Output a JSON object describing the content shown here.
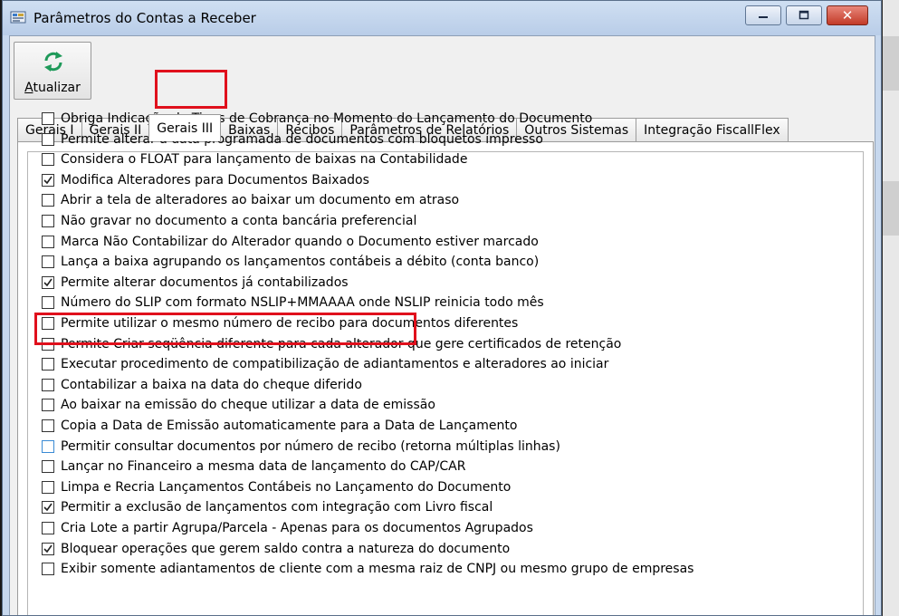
{
  "window": {
    "title": "Parâmetros do Contas a Receber",
    "close_glyph": "✕"
  },
  "toolbar": {
    "refresh_label_first": "A",
    "refresh_label_rest": "tualizar",
    "refresh_icon": "refresh-icon",
    "accent": "#1f9a5a"
  },
  "tabs": [
    {
      "label": "Gerais I",
      "active": false
    },
    {
      "label": "Gerais II",
      "active": false
    },
    {
      "label": "Gerais III",
      "active": true
    },
    {
      "label": "Baixas",
      "active": false
    },
    {
      "label": "Recibos",
      "active": false
    },
    {
      "label": "Parâmetros de Relatórios",
      "active": false
    },
    {
      "label": "Outros Sistemas",
      "active": false
    },
    {
      "label": "Integração FiscallFlex",
      "active": false
    }
  ],
  "highlight_color": "#e0101c",
  "options": [
    {
      "label": "Obriga Indicação de Tipos de Cobrança no Momento do Lançamento do Documento",
      "checked": false
    },
    {
      "label": "Permite alterar a data programada de documentos com bloquetos impresso",
      "checked": false
    },
    {
      "label": "Considera o FLOAT para lançamento de baixas na Contabilidade",
      "checked": false
    },
    {
      "label": "Modifica Alteradores para Documentos Baixados",
      "checked": true
    },
    {
      "label": "Abrir a tela de alteradores ao baixar um documento em atraso",
      "checked": false
    },
    {
      "label": "Não gravar no documento a conta bancária preferencial",
      "checked": false
    },
    {
      "label": "Marca Não Contabilizar do Alterador quando o Documento estiver marcado",
      "checked": false
    },
    {
      "label": "Lança a baixa agrupando os lançamentos contábeis a débito (conta banco)",
      "checked": false
    },
    {
      "label": "Permite alterar documentos já contabilizados",
      "checked": true
    },
    {
      "label": "Número do SLIP com formato NSLIP+MMAAAA onde NSLIP reinicia todo mês",
      "checked": false
    },
    {
      "label": "Permite utilizar o mesmo número de recibo para documentos diferentes",
      "checked": false
    },
    {
      "label": "Permite Criar seqüência diferente para cada alterador que gere certificados de retenção",
      "checked": false
    },
    {
      "label": "Executar procedimento de compatibilização de adiantamentos e alteradores ao iniciar",
      "checked": false
    },
    {
      "label": "Contabilizar a baixa na data do cheque diferido",
      "checked": false
    },
    {
      "label": "Ao baixar na emissão do cheque utilizar a data de emissão",
      "checked": false
    },
    {
      "label": "Copia a Data de Emissão automaticamente para a Data de Lançamento",
      "checked": false
    },
    {
      "label": "Permitir consultar documentos por número de recibo (retorna múltiplas linhas)",
      "checked": false,
      "focused": true
    },
    {
      "label": "Lançar no Financeiro a mesma data de lançamento do CAP/CAR",
      "checked": false
    },
    {
      "label": "Limpa e Recria Lançamentos Contábeis no Lançamento do Documento",
      "checked": false
    },
    {
      "label": "Permitir a exclusão de lançamentos com integração com Livro fiscal",
      "checked": true
    },
    {
      "label": "Cria Lote a partir Agrupa/Parcela - Apenas para os documentos Agrupados",
      "checked": false
    },
    {
      "label": "Bloquear operações que gerem saldo contra a natureza do documento",
      "checked": true
    },
    {
      "label": "Exibir somente adiantamentos de cliente com a mesma raiz de CNPJ ou mesmo grupo de empresas",
      "checked": false
    }
  ]
}
